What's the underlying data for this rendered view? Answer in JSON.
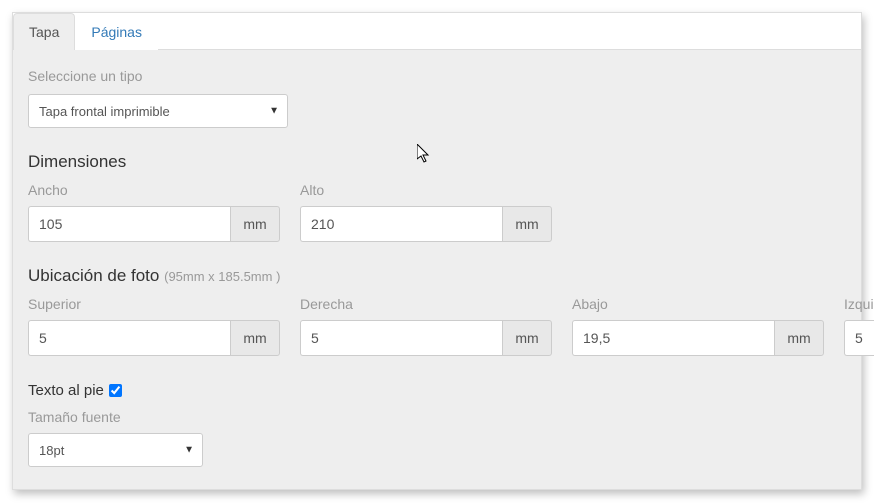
{
  "tabs": {
    "tapa": "Tapa",
    "paginas": "Páginas"
  },
  "type": {
    "label": "Seleccione un tipo",
    "selected": "Tapa frontal imprimible"
  },
  "dimensions": {
    "title": "Dimensiones",
    "width_label": "Ancho",
    "width_value": "105",
    "height_label": "Alto",
    "height_value": "210",
    "unit": "mm"
  },
  "photo": {
    "title": "Ubicación de foto",
    "hint": "(95mm x 185.5mm )",
    "top_label": "Superior",
    "top_value": "5",
    "right_label": "Derecha",
    "right_value": "5",
    "bottom_label": "Abajo",
    "bottom_value": "19,5",
    "left_label": "Izquierda",
    "left_value": "5",
    "unit": "mm"
  },
  "footer": {
    "label": "Texto al pie",
    "checked": true,
    "font_label": "Tamaño fuente",
    "font_value": "18pt"
  }
}
